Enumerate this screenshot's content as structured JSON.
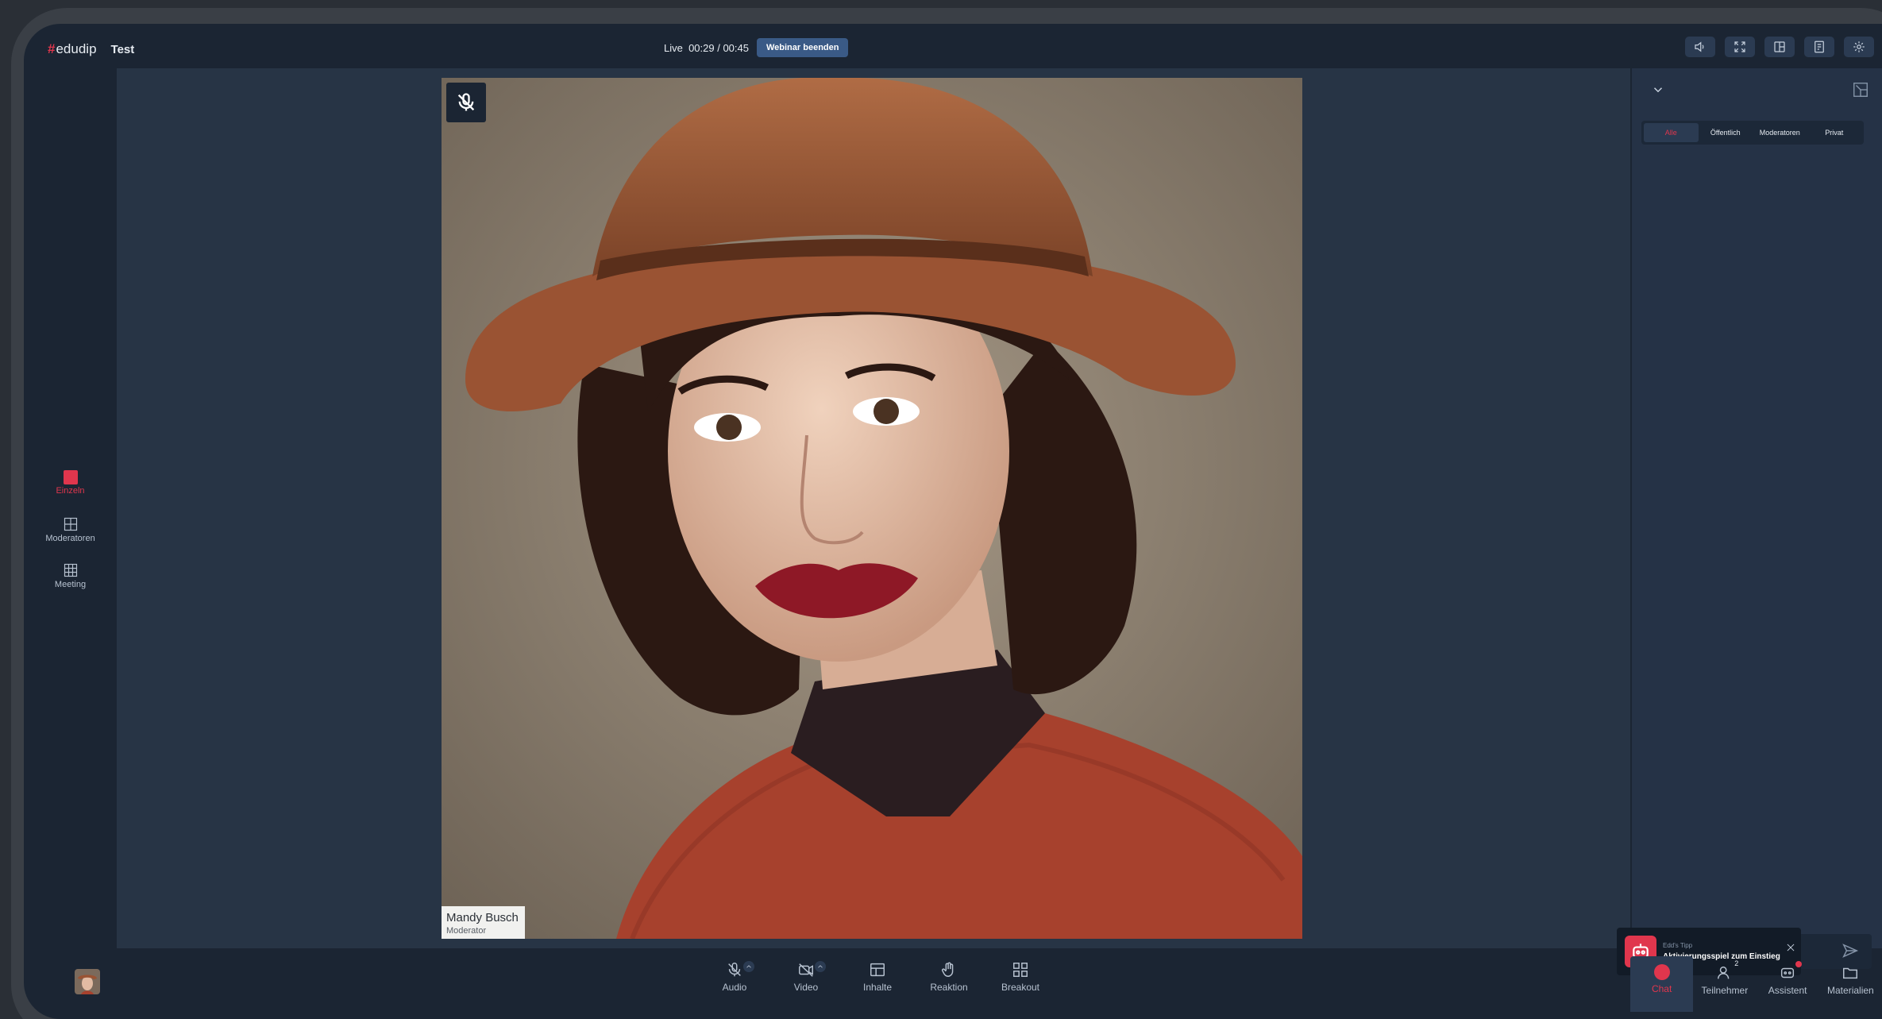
{
  "app": {
    "brand": "edudip",
    "room_name": "Test",
    "live_status": "Live  00:29 / 00:45",
    "end_button": "Webinar beenden"
  },
  "top_icons": [
    "speaker-icon",
    "fullscreen-icon",
    "layout-icon",
    "notes-icon",
    "settings-icon"
  ],
  "left_rail": {
    "items": [
      {
        "label": "Einzeln",
        "icon": "single-view-icon",
        "active": true
      },
      {
        "label": "Moderatoren",
        "icon": "moderators-grid-icon",
        "active": false
      },
      {
        "label": "Meeting",
        "icon": "meeting-grid-icon",
        "active": false
      }
    ]
  },
  "video": {
    "participant_name": "Mandy Busch",
    "participant_role": "Moderator",
    "muted": true
  },
  "chat_panel": {
    "filters": [
      "Alle",
      "Öffentlich",
      "Moderatoren",
      "Privat"
    ],
    "active_filter": "Alle"
  },
  "tip": {
    "label": "Edd's Tipp",
    "title": "Aktivierungsspiel zum Einstieg"
  },
  "controls": [
    {
      "label": "Audio",
      "icon": "mic-off-icon",
      "has_menu": true
    },
    {
      "label": "Video",
      "icon": "camera-off-icon",
      "has_menu": true
    },
    {
      "label": "Inhalte",
      "icon": "content-icon",
      "has_menu": false
    },
    {
      "label": "Reaktion",
      "icon": "hand-icon",
      "has_menu": false
    },
    {
      "label": "Breakout",
      "icon": "breakout-icon",
      "has_menu": false
    }
  ],
  "right_tabs": [
    {
      "label": "Chat",
      "active": true
    },
    {
      "label": "Teilnehmer",
      "count": "2"
    },
    {
      "label": "Assistent",
      "notify": true
    },
    {
      "label": "Materialien"
    }
  ],
  "colors": {
    "accent": "#e0364d",
    "background": "#1b2533",
    "stage": "#273445",
    "button": "#3a5a86"
  }
}
